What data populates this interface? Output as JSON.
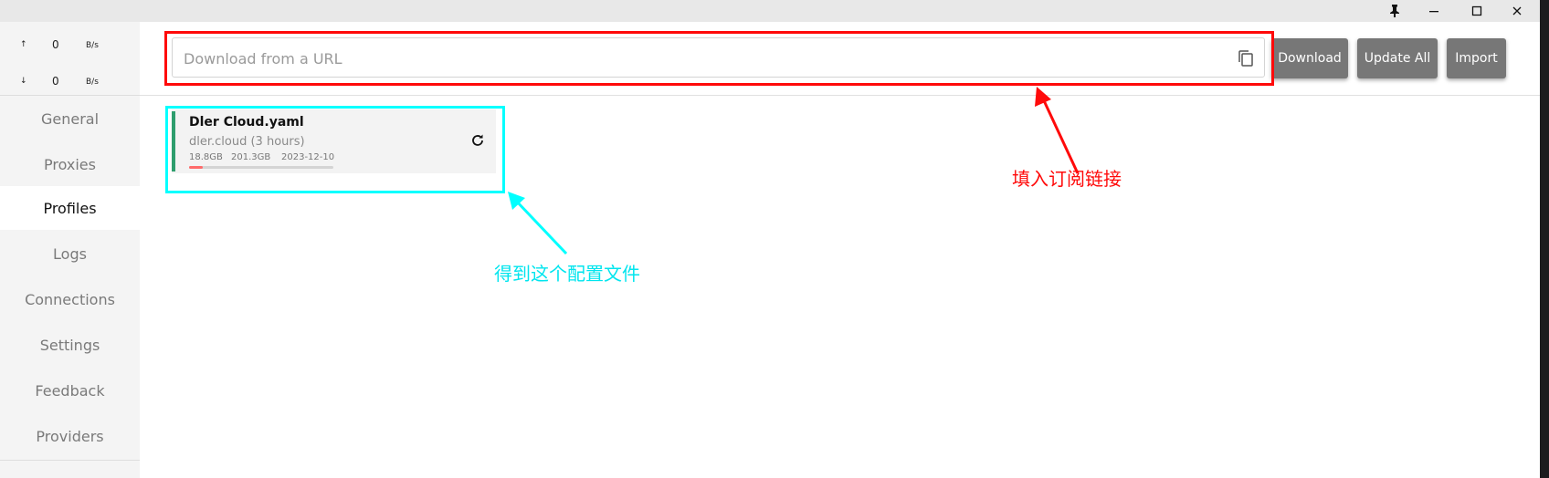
{
  "titlebar": {
    "pin_icon": "pin-icon",
    "minimize_icon": "minimize-icon",
    "maximize_icon": "maximize-icon",
    "close_icon": "close-icon"
  },
  "traffic": {
    "upload": {
      "arrow": "↑",
      "value": "0",
      "unit": "B/s"
    },
    "download": {
      "arrow": "↓",
      "value": "0",
      "unit": "B/s"
    }
  },
  "sidebar": {
    "items": [
      {
        "label": "General"
      },
      {
        "label": "Proxies"
      },
      {
        "label": "Profiles",
        "active": true
      },
      {
        "label": "Logs"
      },
      {
        "label": "Connections"
      },
      {
        "label": "Settings"
      },
      {
        "label": "Feedback"
      },
      {
        "label": "Providers"
      }
    ]
  },
  "toolbar": {
    "url_placeholder": "Download from a URL",
    "url_value": "",
    "download_label": "Download",
    "update_all_label": "Update All",
    "import_label": "Import"
  },
  "profile": {
    "name": "Dler Cloud.yaml",
    "source": "dler.cloud (3 hours)",
    "used": "18.8GB",
    "total": "201.3GB",
    "expire": "2023-12-10",
    "usage_fraction": 0.093
  },
  "annotations": {
    "red_text": "填入订阅链接",
    "cyan_text": "得到这个配置文件"
  },
  "colors": {
    "accent_green": "#2e9e6e",
    "annotation_red": "#ff0a0a",
    "annotation_cyan": "#00ffff",
    "button_gray": "#777777",
    "usage_red": "#ff6b6b"
  }
}
